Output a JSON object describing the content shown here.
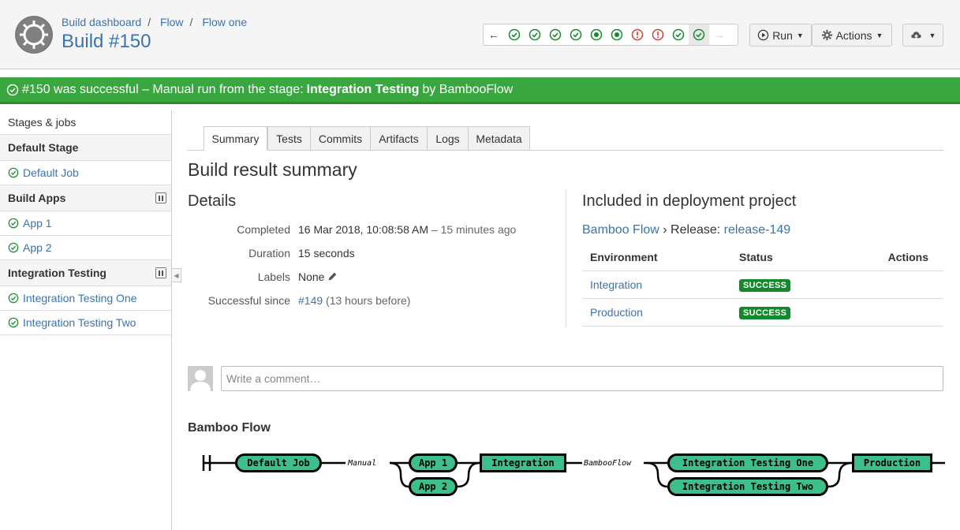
{
  "header": {
    "breadcrumbs": [
      "Build dashboard",
      "Flow",
      "Flow one"
    ],
    "title": "Build #150",
    "history": {
      "prev_icon": "arrow-left-icon",
      "next_icon": "arrow-right-icon",
      "statuses": [
        "success",
        "success",
        "success",
        "success",
        "in-progress",
        "in-progress",
        "failed",
        "failed",
        "success",
        "success-current"
      ]
    },
    "run_label": "Run",
    "actions_label": "Actions",
    "colors": {
      "success": "#14892c",
      "failed": "#d04437",
      "link": "#3b73af"
    }
  },
  "banner": {
    "prefix": "#150 was successful – Manual run from the stage:",
    "stage": "Integration Testing",
    "suffix": "by BambooFlow",
    "color": "#3aa63f"
  },
  "sidebar": {
    "heading": "Stages & jobs",
    "stages": [
      {
        "name": "Default Stage",
        "jobs": [
          "Default Job"
        ]
      },
      {
        "name": "Build Apps",
        "jobs": [
          "App 1",
          "App 2"
        ]
      },
      {
        "name": "Integration Testing",
        "jobs": [
          "Integration Testing One",
          "Integration Testing Two"
        ]
      }
    ]
  },
  "tabs": [
    "Summary",
    "Tests",
    "Commits",
    "Artifacts",
    "Logs",
    "Metadata"
  ],
  "summary": {
    "title": "Build result summary",
    "details_title": "Details",
    "completed_label": "Completed",
    "completed_value": "16 Mar 2018, 10:08:58 AM",
    "completed_relative": "– 15 minutes ago",
    "duration_label": "Duration",
    "duration_value": "15 seconds",
    "labels_label": "Labels",
    "labels_value": "None",
    "since_label": "Successful since",
    "since_link": "#149",
    "since_note": "(13 hours before)"
  },
  "deployment": {
    "title": "Included in deployment project",
    "project": "Bamboo Flow",
    "release_prefix": "› Release:",
    "release": "release-149",
    "columns": [
      "Environment",
      "Status",
      "Actions"
    ],
    "rows": [
      {
        "environment": "Integration",
        "status": "SUCCESS"
      },
      {
        "environment": "Production",
        "status": "SUCCESS"
      }
    ]
  },
  "comment": {
    "placeholder": "Write a comment…"
  },
  "flow": {
    "title": "Bamboo Flow",
    "nodes": [
      "Default Job",
      "App 1",
      "App 2",
      "Integration",
      "Integration Testing One",
      "Integration Testing Two",
      "Production"
    ],
    "edge_labels": [
      "Manual",
      "BambooFlow"
    ]
  }
}
